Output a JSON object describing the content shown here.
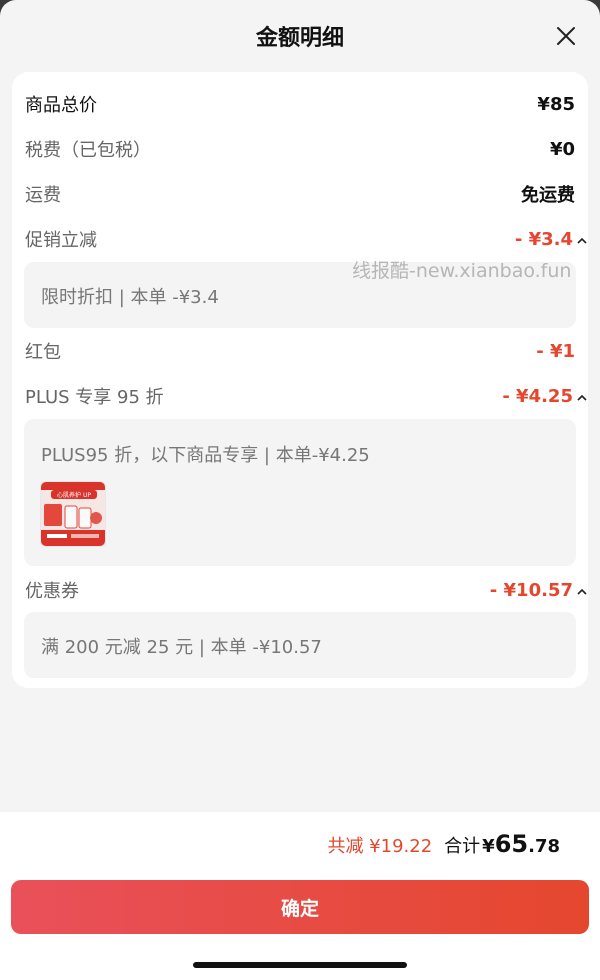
{
  "header": {
    "title": "金额明细"
  },
  "rows": [
    {
      "label": "商品总价",
      "value": "¥85"
    },
    {
      "label": "税费（已包税）",
      "value": "¥0"
    },
    {
      "label": "运费",
      "value": "免运费"
    },
    {
      "label": "促销立减",
      "value": "- ¥3.4"
    },
    {
      "label": "红包",
      "value": "- ¥1"
    },
    {
      "label": "PLUS 专享 95 折",
      "value": "- ¥4.25"
    },
    {
      "label": "优惠券",
      "value": "- ¥10.57"
    }
  ],
  "details": {
    "promo": "限时折扣 | 本单 -¥3.4",
    "plus": "PLUS95 折，以下商品专享 | 本单-¥4.25",
    "coupon": "满 200 元减 25 元 | 本单 -¥10.57"
  },
  "product_thumb": {
    "text": "心肌养护 UP"
  },
  "watermark": "线报酷-new.xianbao.fun",
  "summary": {
    "saved": "共减 ¥19.22",
    "total_label": "合计",
    "total_currency": "¥",
    "total_int": "65",
    "total_dec": ".78"
  },
  "confirm_label": "确定",
  "colors": {
    "accent": "#e5472e",
    "background": "#f4f4f4"
  },
  "icons": {
    "close": "close-icon",
    "expand": "chevron-up-icon"
  }
}
